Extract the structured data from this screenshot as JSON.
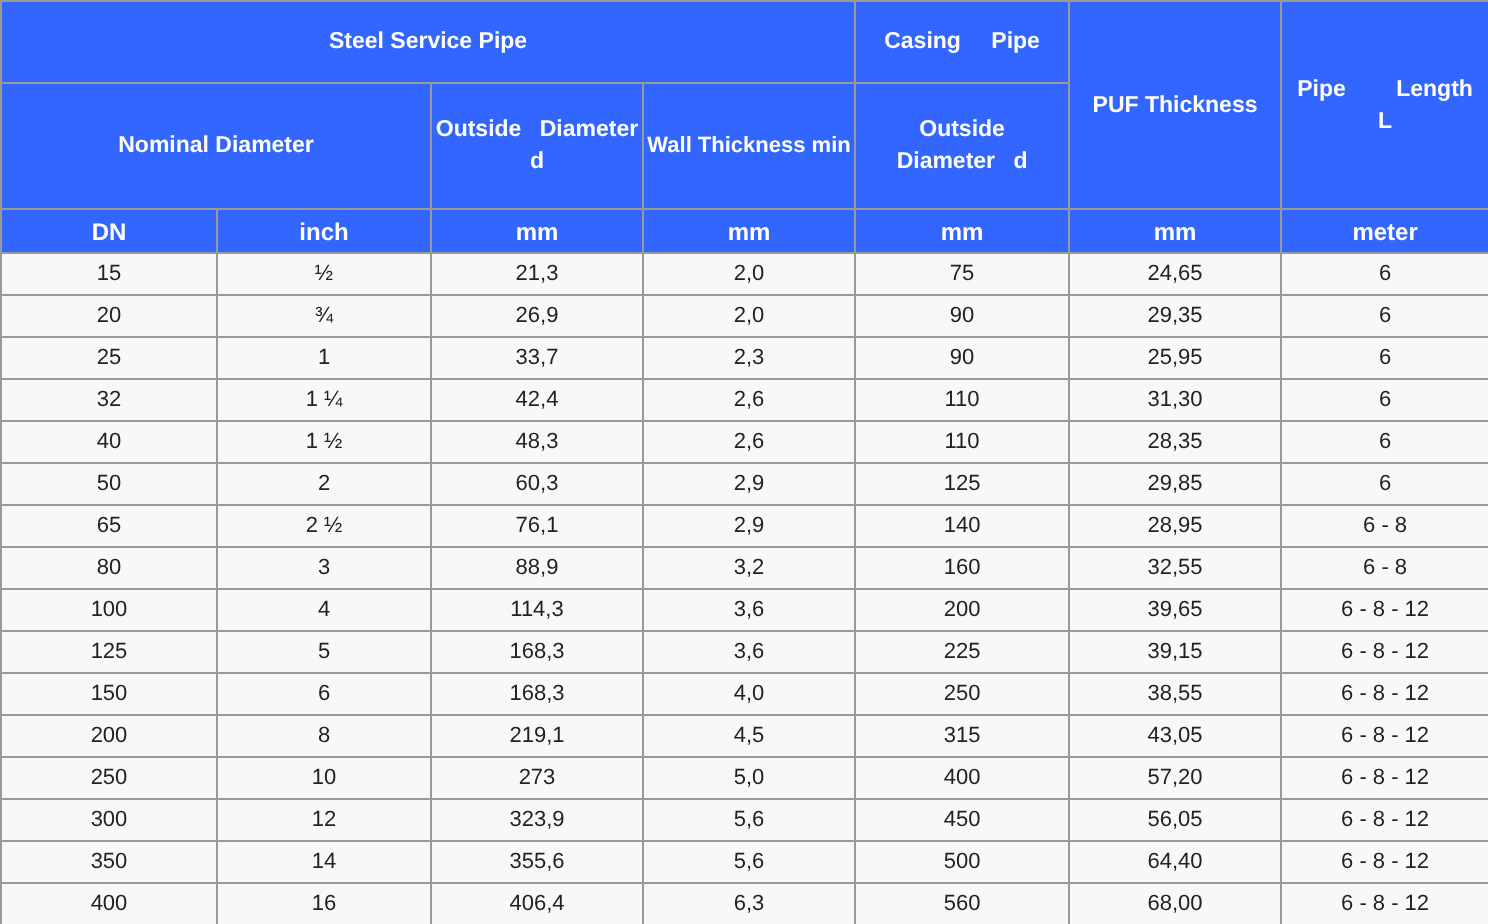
{
  "header": {
    "steel_service_pipe": "Steel Service Pipe",
    "casing_pipe": "Casing Pipe",
    "puf_thickness": "PUF Thickness",
    "pipe_length": "Pipe Length L",
    "nominal_diameter": "Nominal Diameter",
    "outside_diameter": [
      "Outside Diameter",
      "d"
    ],
    "wall_thickness": "Wall Thickness min",
    "casing_outside_diameter": [
      "Outside",
      "Diameter d"
    ]
  },
  "units": [
    "DN",
    "inch",
    "mm",
    "mm",
    "mm",
    "mm",
    "meter"
  ],
  "rows": [
    [
      "15",
      "½",
      "21,3",
      "2,0",
      "75",
      "24,65",
      "6"
    ],
    [
      "20",
      "¾",
      "26,9",
      "2,0",
      "90",
      "29,35",
      "6"
    ],
    [
      "25",
      "1",
      "33,7",
      "2,3",
      "90",
      "25,95",
      "6"
    ],
    [
      "32",
      "1 ¼",
      "42,4",
      "2,6",
      "110",
      "31,30",
      "6"
    ],
    [
      "40",
      "1 ½",
      "48,3",
      "2,6",
      "110",
      "28,35",
      "6"
    ],
    [
      "50",
      "2",
      "60,3",
      "2,9",
      "125",
      "29,85",
      "6"
    ],
    [
      "65",
      "2 ½",
      "76,1",
      "2,9",
      "140",
      "28,95",
      "6 - 8"
    ],
    [
      "80",
      "3",
      "88,9",
      "3,2",
      "160",
      "32,55",
      "6 - 8"
    ],
    [
      "100",
      "4",
      "114,3",
      "3,6",
      "200",
      "39,65",
      "6 - 8 - 12"
    ],
    [
      "125",
      "5",
      "168,3",
      "3,6",
      "225",
      "39,15",
      "6 - 8 - 12"
    ],
    [
      "150",
      "6",
      "168,3",
      "4,0",
      "250",
      "38,55",
      "6 - 8 - 12"
    ],
    [
      "200",
      "8",
      "219,1",
      "4,5",
      "315",
      "43,05",
      "6 - 8 - 12"
    ],
    [
      "250",
      "10",
      "273",
      "5,0",
      "400",
      "57,20",
      "6 - 8 - 12"
    ],
    [
      "300",
      "12",
      "323,9",
      "5,6",
      "450",
      "56,05",
      "6 - 8 - 12"
    ],
    [
      "350",
      "14",
      "355,6",
      "5,6",
      "500",
      "64,40",
      "6 - 8 - 12"
    ],
    [
      "400",
      "16",
      "406,4",
      "6,3",
      "560",
      "68,00",
      "6 - 8 - 12"
    ]
  ]
}
